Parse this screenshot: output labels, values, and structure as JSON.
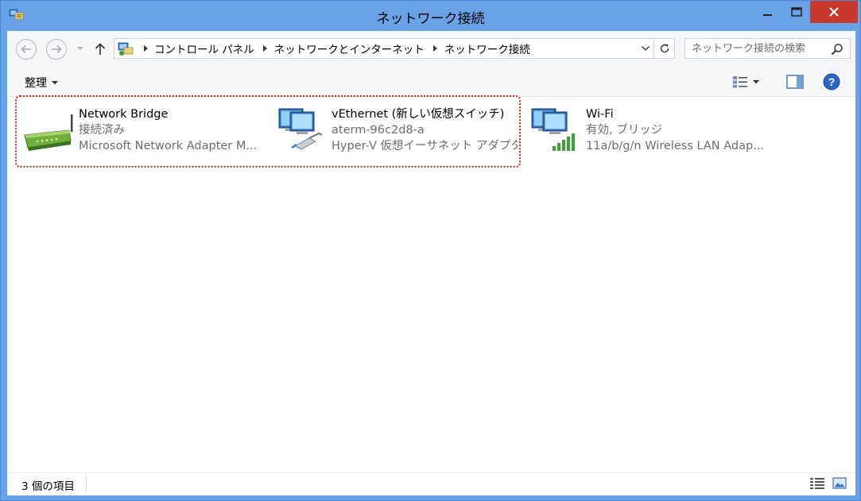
{
  "window": {
    "title": "ネットワーク接続",
    "colors": {
      "frame": "#6aa2e8",
      "close": "#c7392d",
      "selection": "#e2231a"
    }
  },
  "address": {
    "crumbs": [
      "コントロール パネル",
      "ネットワークとインターネット",
      "ネットワーク接続"
    ]
  },
  "search": {
    "placeholder": "ネットワーク接続の検索"
  },
  "toolbar": {
    "organize_label": "整理"
  },
  "items": [
    {
      "name": "Network Bridge",
      "status": "接続済み",
      "device": "Microsoft Network Adapter M...",
      "icon": "network-bridge-icon"
    },
    {
      "name": "vEthernet (新しい仮想スイッチ)",
      "status": "aterm-96c2d8-a",
      "device": "Hyper-V 仮想イーサネット アダプタ...",
      "icon": "wired-network-icon"
    },
    {
      "name": "Wi-Fi",
      "status": "有効, ブリッジ",
      "device": "11a/b/g/n Wireless LAN Adap...",
      "icon": "wireless-network-icon"
    }
  ],
  "statusbar": {
    "item_count": "3 個の項目"
  }
}
